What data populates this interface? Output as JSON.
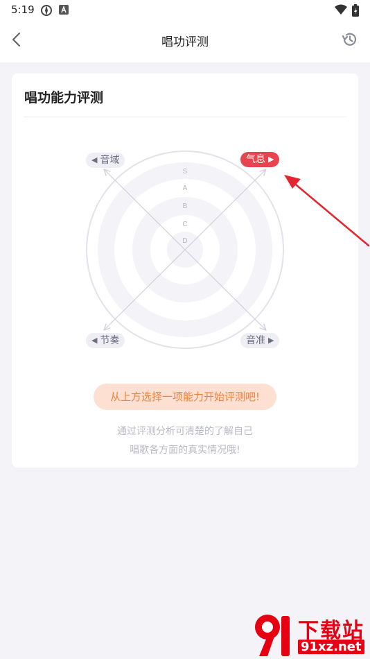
{
  "status_bar": {
    "time": "5:19"
  },
  "app_bar": {
    "title": "唱功评测"
  },
  "card": {
    "title": "唱功能力评测",
    "radar": {
      "grades": [
        "S",
        "A",
        "B",
        "C",
        "D"
      ],
      "axes": {
        "top_left": "音域",
        "top_right": "气息",
        "bottom_left": "节奏",
        "bottom_right": "音准"
      },
      "selected_axis": "top_right"
    },
    "cta": "从上方选择一项能力开始评测吧!",
    "tip_line1": "通过评测分析可清楚的了解自己",
    "tip_line2": "唱歌各方面的真实情况哦!"
  },
  "watermark": {
    "line1": "下载站",
    "line2": "91xz.net"
  },
  "colors": {
    "accent_red": "#e8444f",
    "cta_bg": "#fde0d2",
    "cta_text": "#f0823f"
  }
}
